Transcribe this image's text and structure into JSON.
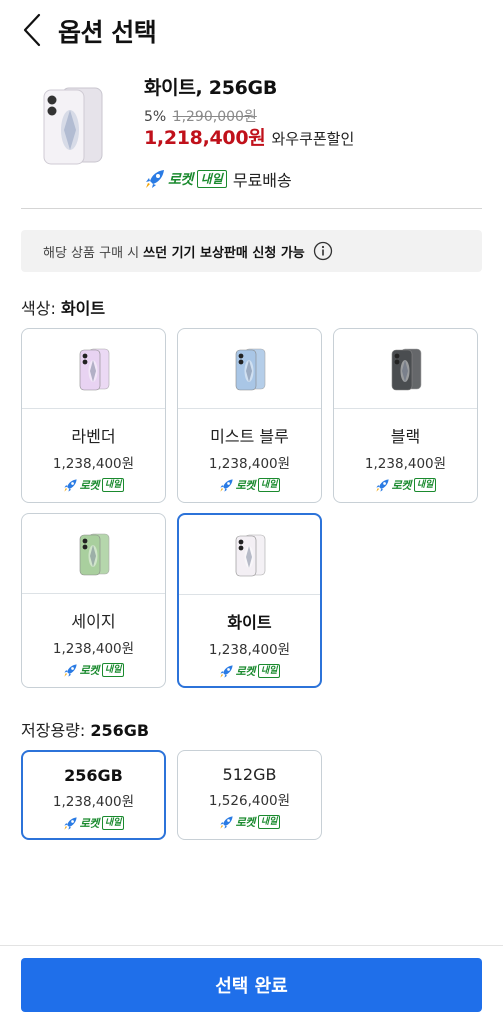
{
  "header": {
    "title": "옵션 선택"
  },
  "product": {
    "name": "화이트, 256GB",
    "discount_rate": "5%",
    "original_price": "1,290,000원",
    "sale_price": "1,218,400원",
    "coupon_label": "와우쿠폰할인",
    "rocket_text": "로켓",
    "rocket_badge": "내일",
    "free_shipping": "무료배송"
  },
  "tradein": {
    "prefix": "해당 상품 구매 시",
    "bold": "쓰던 기기 보상판매 신청 가능"
  },
  "color_section": {
    "label": "색상:",
    "value": "화이트"
  },
  "colors": [
    {
      "name": "라벤더",
      "price": "1,238,400원",
      "rocket": "로켓",
      "badge": "내일",
      "color": "#e8d3f2"
    },
    {
      "name": "미스트 블루",
      "price": "1,238,400원",
      "rocket": "로켓",
      "badge": "내일",
      "color": "#a9c6e6"
    },
    {
      "name": "블랙",
      "price": "1,238,400원",
      "rocket": "로켓",
      "badge": "내일",
      "color": "#4a4d50"
    },
    {
      "name": "세이지",
      "price": "1,238,400원",
      "rocket": "로켓",
      "badge": "내일",
      "color": "#a9cf9e"
    },
    {
      "name": "화이트",
      "price": "1,238,400원",
      "rocket": "로켓",
      "badge": "내일",
      "color": "#f3eff4",
      "selected": true
    }
  ],
  "capacity_section": {
    "label": "저장용량:",
    "value": "256GB"
  },
  "capacities": [
    {
      "name": "256GB",
      "price": "1,238,400원",
      "rocket": "로켓",
      "badge": "내일",
      "selected": true
    },
    {
      "name": "512GB",
      "price": "1,526,400원",
      "rocket": "로켓",
      "badge": "내일"
    }
  ],
  "footer": {
    "confirm_label": "선택 완료"
  },
  "theme": {
    "accent": "#1f6fea",
    "selected_border": "#2c73d9",
    "sale_red": "#c0111b",
    "rocket_green": "#1a8a2e"
  }
}
